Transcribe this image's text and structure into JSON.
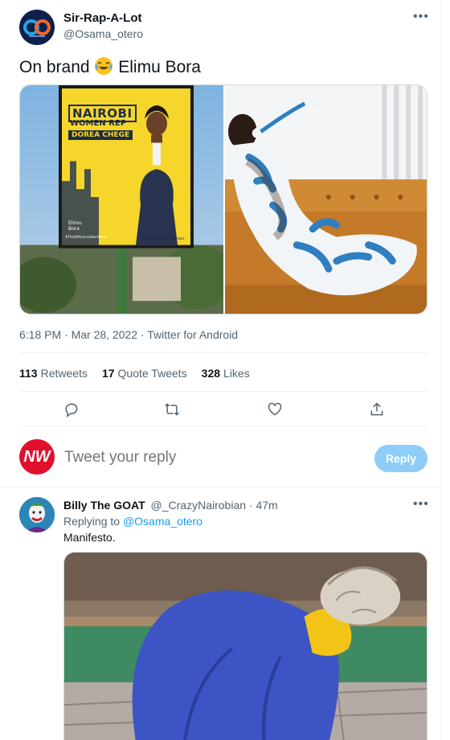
{
  "tweet": {
    "author_name": "Sir-Rap-A-Lot",
    "author_handle": "@Osama_otero",
    "more_icon": "more-horizontal-icon",
    "text_before_emoji": "On brand ",
    "emoji": "face-with-tears-of-joy",
    "text_after_emoji": " Elimu Bora",
    "poster": {
      "line1": "NAIROBI",
      "line2": "WOMEN REP",
      "line3": "DOREA CHEGE",
      "brand": "Elimu\nBora",
      "hashtag": "#TheDifferenceStartsNow",
      "tag": "Independent candidate"
    },
    "timestamp": "6:18 PM · Mar 28, 2022 · Twitter for Android",
    "stats": {
      "retweets_count": "113",
      "retweets_label": "Retweets",
      "quotes_count": "17",
      "quotes_label": "Quote Tweets",
      "likes_count": "328",
      "likes_label": "Likes"
    },
    "actions": [
      "reply-icon",
      "retweet-icon",
      "like-icon",
      "share-icon"
    ]
  },
  "compose": {
    "avatar_text": "NW",
    "placeholder": "Tweet your reply",
    "button_label": "Reply"
  },
  "reply": {
    "author_name": "Billy The GOAT",
    "author_handle": "@_CrazyNairobian",
    "time": "· 47m",
    "replying_prefix": "Replying to",
    "replying_to": "@Osama_otero",
    "text": "Manifesto."
  },
  "colors": {
    "accent": "#1d9bf0",
    "reply_button": "#8ecdf8",
    "secondary_text": "#536471",
    "divider": "#eff3f4",
    "nw_red": "#e0102d"
  }
}
